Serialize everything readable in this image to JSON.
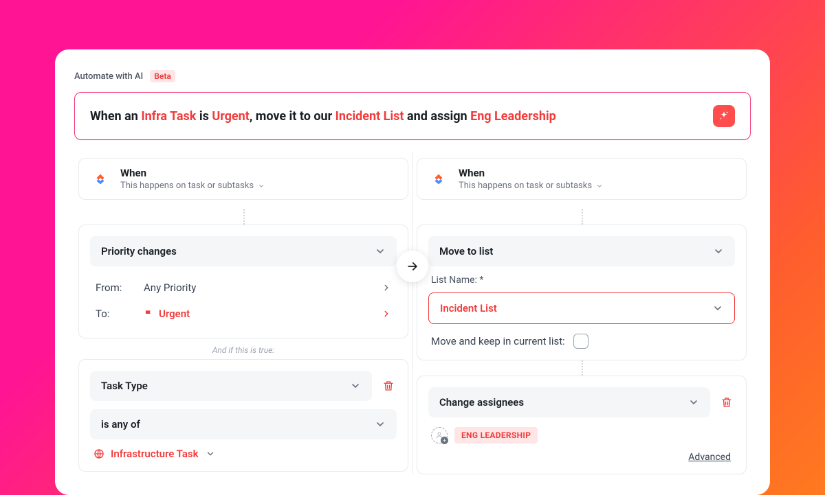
{
  "header": {
    "label": "Automate with AI",
    "badge": "Beta"
  },
  "prompt": {
    "segments": [
      {
        "t": "When an ",
        "hl": false
      },
      {
        "t": "Infra Task",
        "hl": true
      },
      {
        "t": " is ",
        "hl": false
      },
      {
        "t": "Urgent",
        "hl": true
      },
      {
        "t": ", move it to our ",
        "hl": false
      },
      {
        "t": "Incident List",
        "hl": true
      },
      {
        "t": " and assign ",
        "hl": false
      },
      {
        "t": "Eng Leadership",
        "hl": true
      }
    ]
  },
  "when_card": {
    "title": "When",
    "subtitle": "This happens on task or subtasks"
  },
  "trigger": {
    "title": "Priority changes",
    "from_label": "From:",
    "from_value": "Any Priority",
    "to_label": "To:",
    "to_value": "Urgent"
  },
  "condition": {
    "and_if_label": "And if this is true:",
    "field": "Task Type",
    "operator": "is any of",
    "value": "Infrastructure Task"
  },
  "action_move": {
    "title": "Move to list",
    "list_label": "List Name: *",
    "list_value": "Incident List",
    "keep_label": "Move and keep in current list:"
  },
  "action_assign": {
    "title": "Change assignees",
    "badge": "ENG LEADERSHIP",
    "advanced": "Advanced"
  }
}
